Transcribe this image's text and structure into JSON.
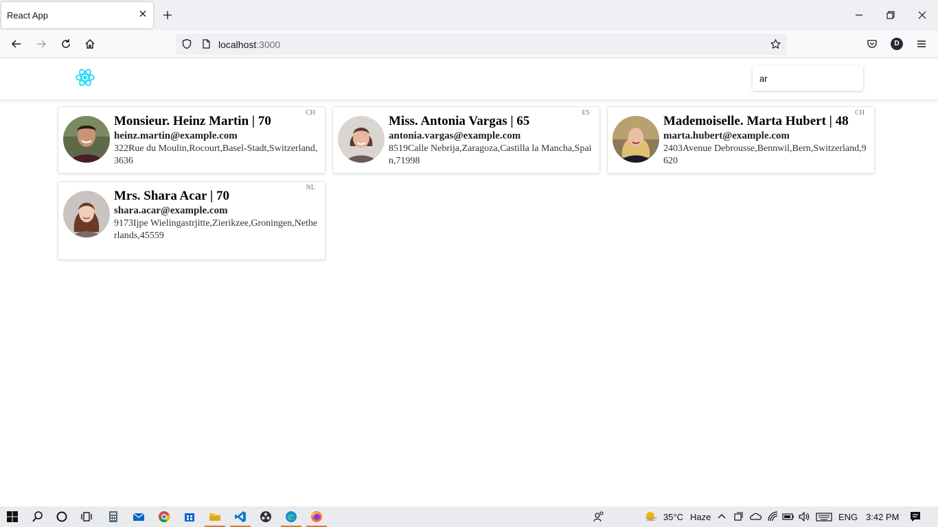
{
  "browser": {
    "tab_title": "React App",
    "url_host": "localhost",
    "url_port": ":3000",
    "profile_initial": "D"
  },
  "header": {
    "search_value": "ar"
  },
  "cards": [
    {
      "name": "Monsieur. Heinz Martin | 70",
      "email": "heinz.martin@example.com",
      "address": "322Rue du Moulin,Rocourt,Basel-Stadt,Switzerland,3636",
      "country": "CH"
    },
    {
      "name": "Miss. Antonia Vargas | 65",
      "email": "antonia.vargas@example.com",
      "address": "8519Calle Nebrija,Zaragoza,Castilla la Mancha,Spain,71998",
      "country": "ES"
    },
    {
      "name": "Mademoiselle. Marta Hubert | 48",
      "email": "marta.hubert@example.com",
      "address": "2403Avenue Debrousse,Bennwil,Bern,Switzerland,9620",
      "country": "CH"
    },
    {
      "name": "Mrs. Shara Acar | 70",
      "email": "shara.acar@example.com",
      "address": "9173Ijpe Wielingastrjitte,Zierikzee,Groningen,Netherlands,45559",
      "country": "NL"
    }
  ],
  "taskbar": {
    "temperature": "35°C",
    "weather": "Haze",
    "language": "ENG",
    "time": "3:42 PM"
  },
  "colors": {
    "react_accent": "#00d8ff",
    "taskbar_active": "#d67a2c"
  }
}
